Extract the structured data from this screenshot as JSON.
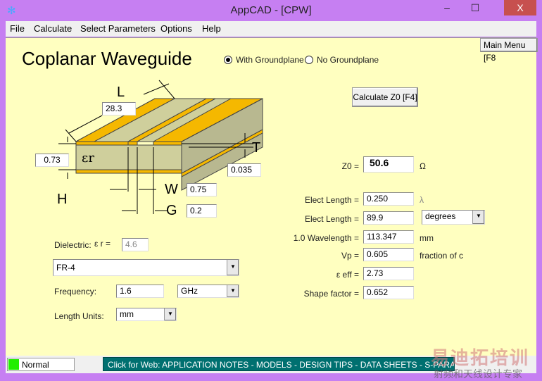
{
  "window": {
    "title": "AppCAD - [CPW]",
    "minimize": "–",
    "maximize": "☐",
    "close": "X"
  },
  "menu": [
    "File",
    "Calculate",
    "Select Parameters",
    "Options",
    "Help"
  ],
  "main_menu_button": "Main Menu [F8",
  "page_title": "Coplanar Waveguide",
  "groundplane": {
    "options": [
      "With Groundplane",
      "No Groundplane"
    ],
    "selected": 0
  },
  "calculate_button": "Calculate Z0  [F4]",
  "diagram": {
    "L_label": "L",
    "T_label": "T",
    "W_label": "W",
    "G_label": "G",
    "H_label": "H",
    "er_label": "εr",
    "L": "28.3",
    "H": "0.73",
    "T": "0.035",
    "W": "0.75",
    "G": "0.2"
  },
  "dielectric": {
    "label": "Dielectric:",
    "er_label": "ε r =",
    "er_value": "4.6",
    "material": "FR-4"
  },
  "frequency": {
    "label": "Frequency:",
    "value": "1.6",
    "unit": "GHz"
  },
  "length_units": {
    "label": "Length Units:",
    "value": "mm"
  },
  "results": {
    "z0": {
      "label": "Z0 =",
      "value": "50.6",
      "unit": "Ω"
    },
    "elect_len_wl": {
      "label": "Elect Length =",
      "value": "0.250",
      "unit": "λ"
    },
    "elect_len_deg": {
      "label": "Elect Length =",
      "value": "89.9",
      "unit": "degrees"
    },
    "wavelength": {
      "label": "1.0 Wavelength =",
      "value": "113.347",
      "unit": "mm"
    },
    "vp": {
      "label": "Vp =",
      "value": "0.605",
      "unit": "fraction of c"
    },
    "eeff": {
      "label": "ε eff =",
      "value": "2.73"
    },
    "shape": {
      "label": "Shape factor =",
      "value": "0.652"
    }
  },
  "status": {
    "mode": "Normal",
    "web_link": "Click for Web: APPLICATION NOTES - MODELS - DESIGN TIPS - DATA SHEETS - S-PARAMETERS"
  },
  "watermark": {
    "line1": "易迪拓培训",
    "line2": "射频和天线设计专家"
  },
  "colors": {
    "frame": "#c67ff2",
    "panel": "#ffffc0",
    "copper": "#f5b800",
    "substrate": "#cfcf9c",
    "status_green": "#22ee00",
    "link_bg": "#007070"
  }
}
